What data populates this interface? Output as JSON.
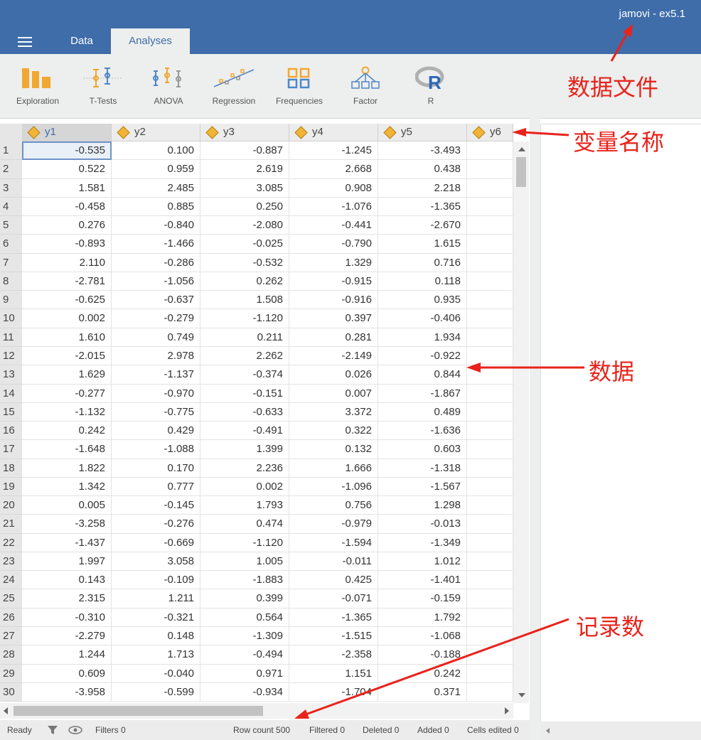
{
  "app_title": "jamovi - ex5.1",
  "tabs": [
    {
      "label": "Data"
    },
    {
      "label": "Analyses"
    }
  ],
  "ribbon": [
    {
      "label": "Exploration",
      "icon": "exploration-icon"
    },
    {
      "label": "T-Tests",
      "icon": "t-tests-icon"
    },
    {
      "label": "ANOVA",
      "icon": "anova-icon"
    },
    {
      "label": "Regression",
      "icon": "regression-icon"
    },
    {
      "label": "Frequencies",
      "icon": "frequencies-icon"
    },
    {
      "label": "Factor",
      "icon": "factor-icon"
    },
    {
      "label": "R",
      "icon": "r-icon"
    }
  ],
  "columns": [
    "y1",
    "y2",
    "y3",
    "y4",
    "y5",
    "y6"
  ],
  "rows": [
    [
      "1",
      "-0.535",
      "0.100",
      "-0.887",
      "-1.245",
      "-3.493"
    ],
    [
      "2",
      "0.522",
      "0.959",
      "2.619",
      "2.668",
      "0.438"
    ],
    [
      "3",
      "1.581",
      "2.485",
      "3.085",
      "0.908",
      "2.218"
    ],
    [
      "4",
      "-0.458",
      "0.885",
      "0.250",
      "-1.076",
      "-1.365"
    ],
    [
      "5",
      "0.276",
      "-0.840",
      "-2.080",
      "-0.441",
      "-2.670"
    ],
    [
      "6",
      "-0.893",
      "-1.466",
      "-0.025",
      "-0.790",
      "1.615"
    ],
    [
      "7",
      "2.110",
      "-0.286",
      "-0.532",
      "1.329",
      "0.716"
    ],
    [
      "8",
      "-2.781",
      "-1.056",
      "0.262",
      "-0.915",
      "0.118"
    ],
    [
      "9",
      "-0.625",
      "-0.637",
      "1.508",
      "-0.916",
      "0.935"
    ],
    [
      "10",
      "0.002",
      "-0.279",
      "-1.120",
      "0.397",
      "-0.406"
    ],
    [
      "11",
      "1.610",
      "0.749",
      "0.211",
      "0.281",
      "1.934"
    ],
    [
      "12",
      "-2.015",
      "2.978",
      "2.262",
      "-2.149",
      "-0.922"
    ],
    [
      "13",
      "1.629",
      "-1.137",
      "-0.374",
      "0.026",
      "0.844"
    ],
    [
      "14",
      "-0.277",
      "-0.970",
      "-0.151",
      "0.007",
      "-1.867"
    ],
    [
      "15",
      "-1.132",
      "-0.775",
      "-0.633",
      "3.372",
      "0.489"
    ],
    [
      "16",
      "0.242",
      "0.429",
      "-0.491",
      "0.322",
      "-1.636"
    ],
    [
      "17",
      "-1.648",
      "-1.088",
      "1.399",
      "0.132",
      "0.603"
    ],
    [
      "18",
      "1.822",
      "0.170",
      "2.236",
      "1.666",
      "-1.318"
    ],
    [
      "19",
      "1.342",
      "0.777",
      "0.002",
      "-1.096",
      "-1.567"
    ],
    [
      "20",
      "0.005",
      "-0.145",
      "1.793",
      "0.756",
      "1.298"
    ],
    [
      "21",
      "-3.258",
      "-0.276",
      "0.474",
      "-0.979",
      "-0.013"
    ],
    [
      "22",
      "-1.437",
      "-0.669",
      "-1.120",
      "-1.594",
      "-1.349"
    ],
    [
      "23",
      "1.997",
      "3.058",
      "1.005",
      "-0.011",
      "1.012"
    ],
    [
      "24",
      "0.143",
      "-0.109",
      "-1.883",
      "0.425",
      "-1.401"
    ],
    [
      "25",
      "2.315",
      "1.211",
      "0.399",
      "-0.071",
      "-0.159"
    ],
    [
      "26",
      "-0.310",
      "-0.321",
      "0.564",
      "-1.365",
      "1.792"
    ],
    [
      "27",
      "-2.279",
      "0.148",
      "-1.309",
      "-1.515",
      "-1.068"
    ],
    [
      "28",
      "1.244",
      "1.713",
      "-0.494",
      "-2.358",
      "-0.188"
    ],
    [
      "29",
      "0.609",
      "-0.040",
      "0.971",
      "1.151",
      "0.242"
    ],
    [
      "30",
      "-3.958",
      "-0.599",
      "-0.934",
      "-1.704",
      "0.371"
    ]
  ],
  "status": {
    "ready": "Ready",
    "filters": "Filters 0",
    "row_count": "Row count 500",
    "filtered": "Filtered 0",
    "deleted": "Deleted 0",
    "added": "Added 0",
    "cells_edited": "Cells edited 0"
  },
  "annotations": {
    "data_file": "数据文件",
    "variable_names": "变量名称",
    "data": "数据",
    "record_count": "记录数"
  },
  "colors": {
    "header": "#3e6da9",
    "annotation": "#e8231b",
    "variable_tag": "#f1b436"
  }
}
